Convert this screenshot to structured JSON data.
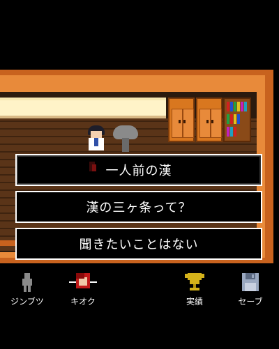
{
  "dialog": {
    "choices": [
      {
        "label": "一人前の漢"
      },
      {
        "label": "漢の三ヶ条って？"
      },
      {
        "label": "聞きたいことはない"
      }
    ]
  },
  "menu": {
    "items": [
      {
        "label": "ジンブツ",
        "icon": "person-silhouette-icon"
      },
      {
        "label": "キオク",
        "icon": "memory-portrait-icon"
      },
      {
        "label": "実績",
        "icon": "trophy-icon"
      },
      {
        "label": "セーブ",
        "icon": "floppy-disk-icon"
      }
    ]
  },
  "colors": {
    "wall_orange": "#e88a3a",
    "panel_brown": "#5a3418",
    "trophy_gold": "#d4b21a",
    "save_blue": "#9aa8c0"
  }
}
